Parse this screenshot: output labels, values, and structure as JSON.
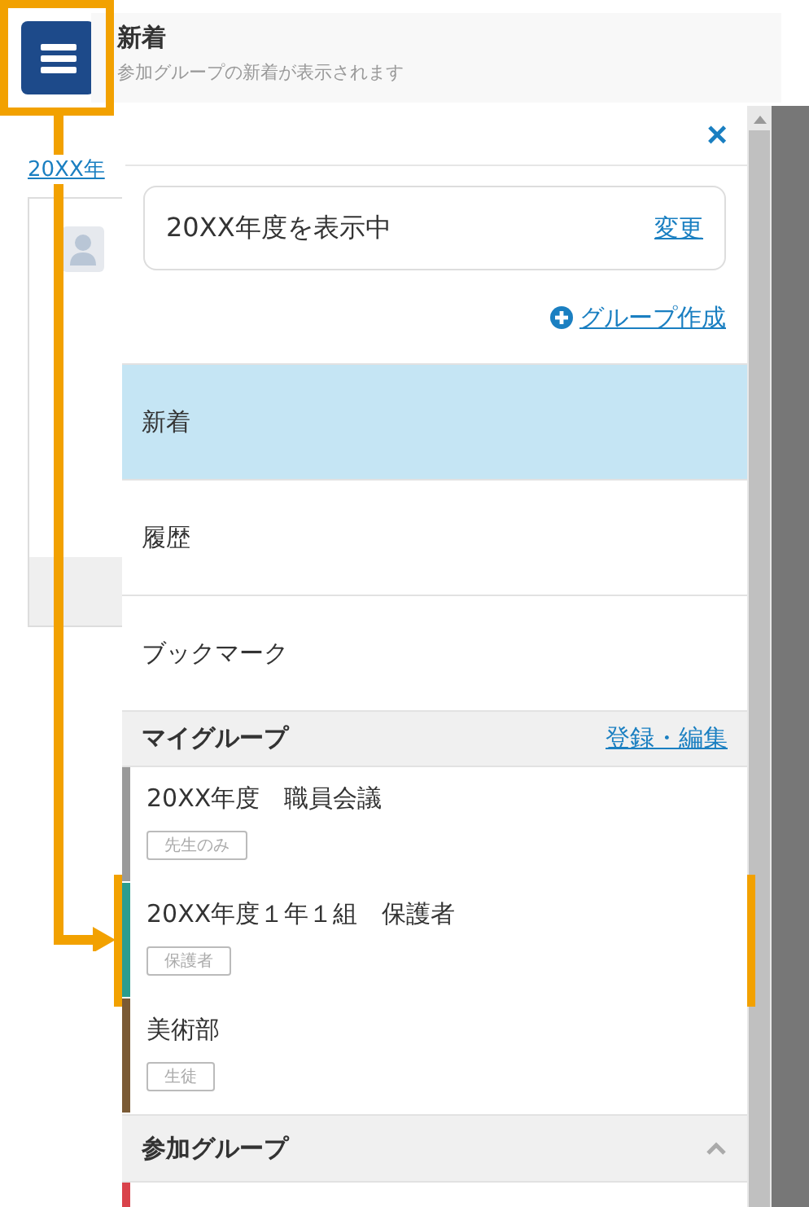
{
  "header": {
    "title": "新着",
    "subtitle": "参加グループの新着が表示されます"
  },
  "background": {
    "link": "20XX年"
  },
  "drawer": {
    "close": "×",
    "year_box": {
      "text": "20XX年度を表示中",
      "change_link": "変更"
    },
    "create_group_link": "グループ作成",
    "nav": [
      {
        "label": "新着",
        "selected": true
      },
      {
        "label": "履歴",
        "selected": false
      },
      {
        "label": "ブックマーク",
        "selected": false
      }
    ],
    "my_groups": {
      "title": "マイグループ",
      "edit_link": "登録・編集",
      "items": [
        {
          "name": "20XX年度　職員会議",
          "tag": "先生のみ",
          "color": "#9a9a9a"
        },
        {
          "name": "20XX年度１年１組　保護者",
          "tag": "保護者",
          "color": "#2a9d8f"
        },
        {
          "name": "美術部",
          "tag": "生徒",
          "color": "#7a5a35"
        }
      ]
    },
    "joined_groups": {
      "title": "参加グループ",
      "expanded": true,
      "items": [
        {
          "color": "#d9434b"
        }
      ]
    }
  }
}
